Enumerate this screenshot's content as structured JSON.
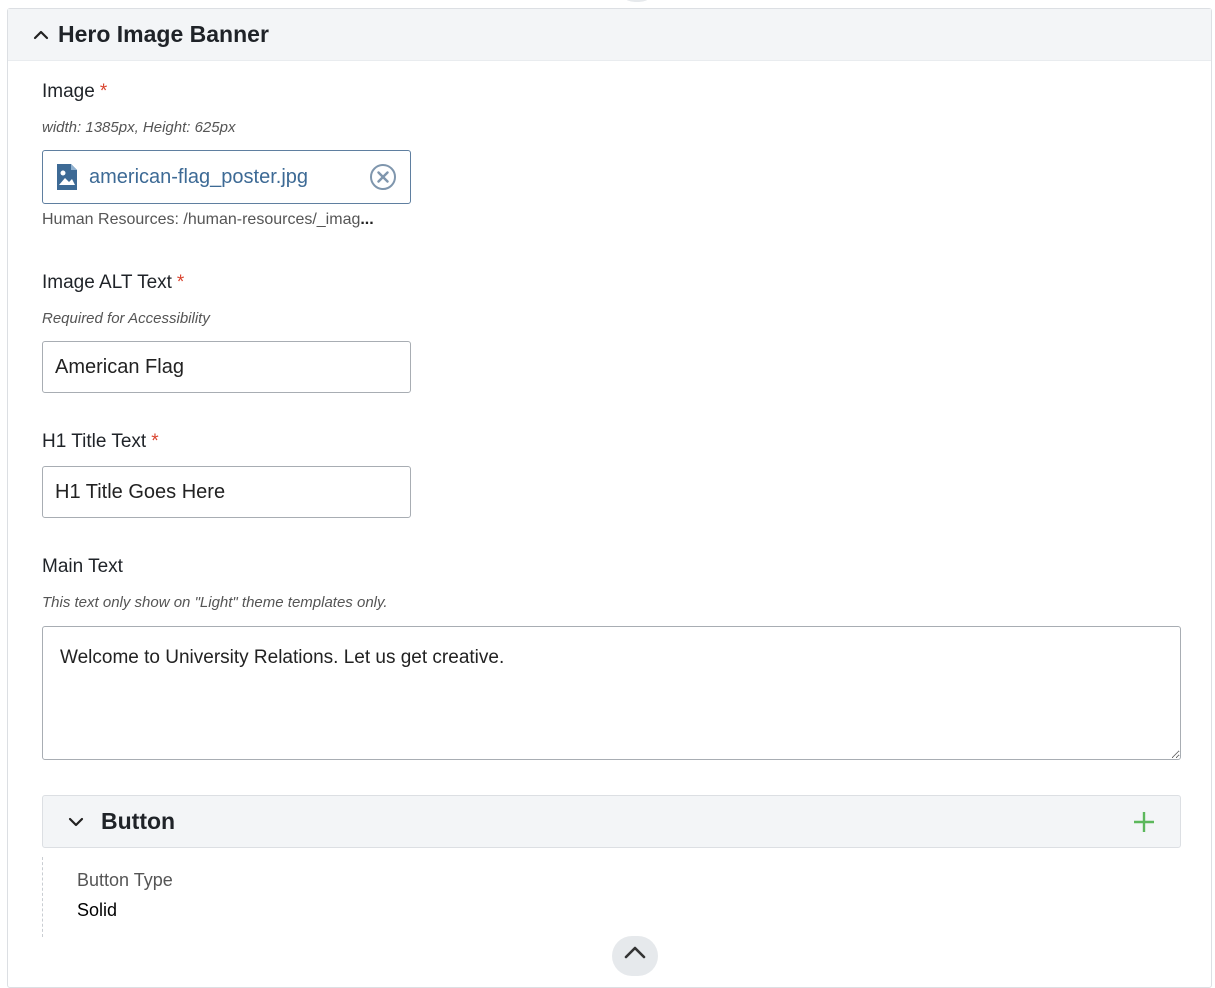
{
  "section": {
    "title": "Hero Image Banner",
    "collapse_icon": "chevron-up-icon"
  },
  "image_field": {
    "label": "Image",
    "required_mark": "*",
    "help": "width: 1385px, Height: 625px",
    "file_name": "american-flag_poster.jpg",
    "file_icon": "image-file-icon",
    "remove_icon": "remove-circle-icon",
    "path_prefix": "Human Resources: /human-resources/_imag",
    "path_ellipsis": "..."
  },
  "alt_field": {
    "label": "Image ALT Text",
    "required_mark": "*",
    "help": "Required for Accessibility",
    "value": "American Flag"
  },
  "title_field": {
    "label": "H1 Title Text",
    "required_mark": "*",
    "value": "H1 Title Goes Here"
  },
  "main_text_field": {
    "label": "Main Text",
    "help": "This text only show on \"Light\" theme templates only.",
    "value": "Welcome to University Relations. Let us get creative."
  },
  "button_section": {
    "title": "Button",
    "expand_icon": "chevron-down-icon",
    "add_icon": "plus-icon",
    "type_label": "Button Type",
    "type_value": "Solid"
  },
  "colors": {
    "required": "#d9442f",
    "link": "#3d6a95",
    "add": "#5cb85c",
    "header_bg": "#f3f5f7"
  }
}
